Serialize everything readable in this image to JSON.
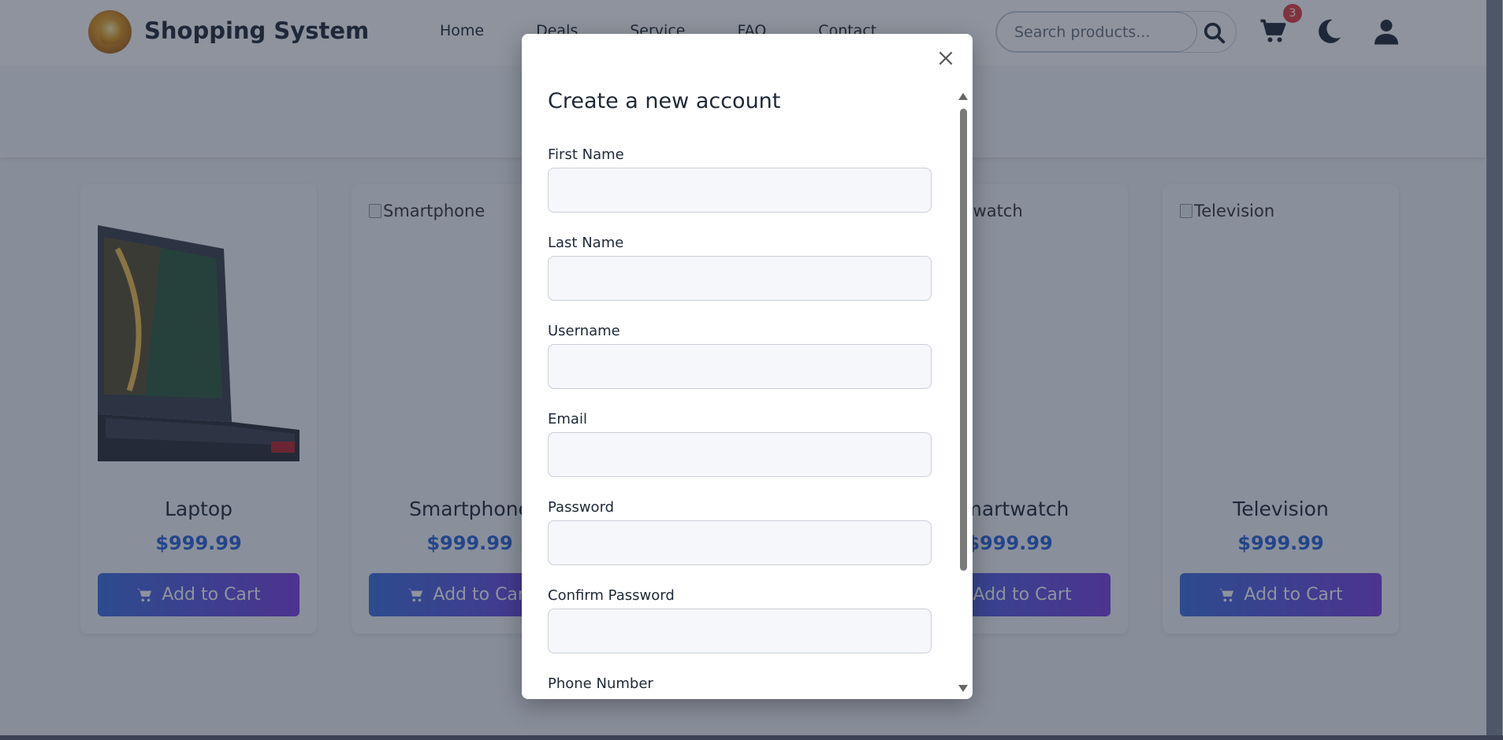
{
  "header": {
    "brand": "Shopping System",
    "nav": [
      "Home",
      "Deals",
      "Service",
      "FAQ",
      "Contact"
    ],
    "search_placeholder": "Search products...",
    "cart_count": "3",
    "icons": {
      "search": "search-icon",
      "cart": "cart-icon",
      "theme": "moon-icon",
      "account": "user-icon"
    }
  },
  "products": [
    {
      "name": "Laptop",
      "price": "$999.99",
      "alt": "",
      "button": "Add to Cart"
    },
    {
      "name": "Smartphone",
      "price": "$999.99",
      "alt": "Smartphone",
      "button": "Add to Cart"
    },
    {
      "name": "Smartwatch",
      "price": "$999.99",
      "alt": "Smartwatch",
      "button": "Add to Cart"
    },
    {
      "name": "Television",
      "price": "$999.99",
      "alt": "Television",
      "button": "Add to Cart"
    }
  ],
  "modal": {
    "title": "Create a new account",
    "fields": [
      "First Name",
      "Last Name",
      "Username",
      "Email",
      "Password",
      "Confirm Password",
      "Phone Number"
    ]
  },
  "colors": {
    "accent_blue": "#2b63d9",
    "button_gradient_start": "#3c6fe0",
    "button_gradient_end": "#7b3fe4",
    "badge": "#e53e3e"
  }
}
